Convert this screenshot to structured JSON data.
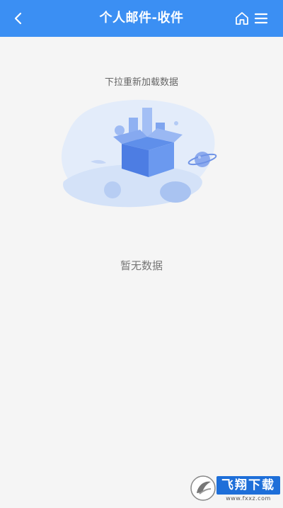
{
  "header": {
    "title": "个人邮件-收件",
    "back_icon": "chevron-left-icon",
    "home_icon": "home-icon",
    "menu_icon": "menu-icon",
    "bg_color": "#3b8ff3"
  },
  "main": {
    "pull_hint": "下拉重新加载数据",
    "empty_text": "暂无数据",
    "illustration_icon": "empty-box-illustration"
  },
  "watermark": {
    "brand": "飞翔下载",
    "site": "www.fxxz.com"
  }
}
